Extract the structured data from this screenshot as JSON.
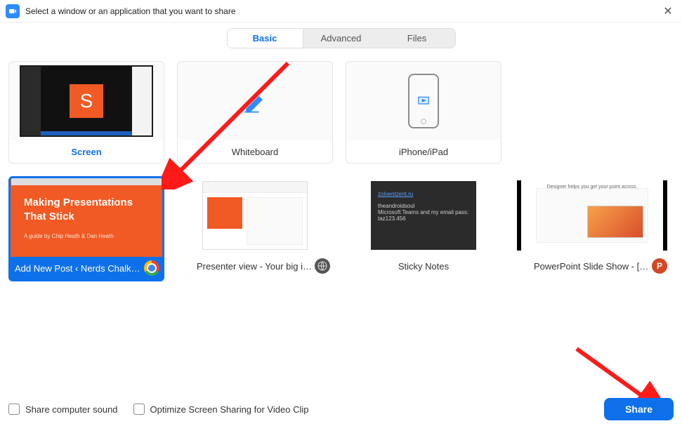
{
  "titlebar": {
    "title": "Select a window or an application that you want to share"
  },
  "tabs": {
    "basic": "Basic",
    "advanced": "Advanced",
    "files": "Files",
    "active": "basic"
  },
  "tiles": {
    "screen": {
      "label": "Screen"
    },
    "whiteboard": {
      "label": "Whiteboard"
    },
    "iphone": {
      "label": "iPhone/iPad"
    },
    "chrome": {
      "label": "Add New Post ‹ Nerds Chalk — ...",
      "thumb_title": "Making Presentations That Stick",
      "thumb_sub": "A guide by Chip Heath & Dan Heath"
    },
    "presenter": {
      "label": "Presenter view - Your big idea - G..."
    },
    "sticky": {
      "label": "Sticky Notes",
      "link_text": "zoloentzent.ru",
      "line1": "theandroidsoul",
      "line2": "Microsoft Teams and my email pass:",
      "line3": "taz123.456"
    },
    "ppt": {
      "label": "PowerPoint Slide Show - [Present...",
      "caption": "Designer helps you get your point across."
    }
  },
  "footer": {
    "share_sound": "Share computer sound",
    "optimize": "Optimize Screen Sharing for Video Clip",
    "share_button": "Share"
  },
  "colors": {
    "primary": "#0E71EB",
    "orange": "#f15a24"
  }
}
